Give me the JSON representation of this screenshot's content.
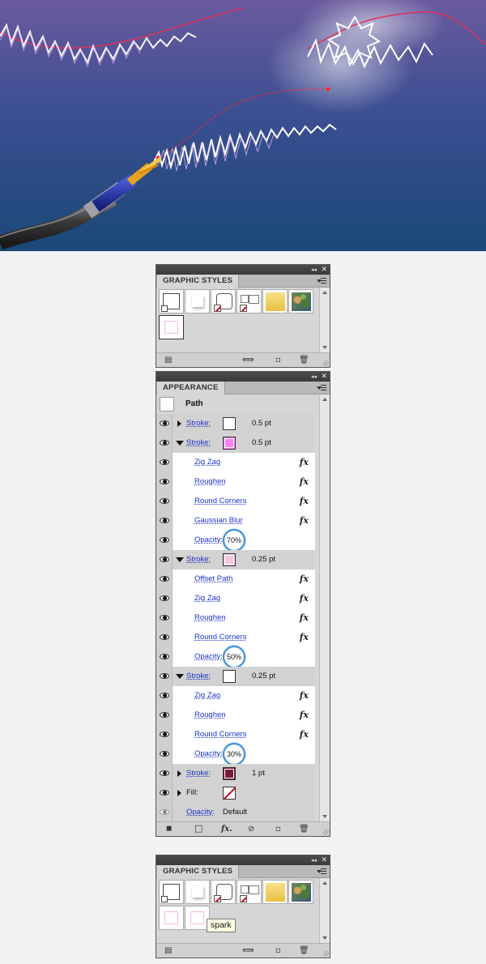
{
  "graphic_styles_panel_1": {
    "tab_label": "GRAPHIC STYLES",
    "swatches": [
      {
        "name": "default",
        "color": "#ffffff"
      },
      {
        "name": "shadow",
        "color": "#ffffff"
      },
      {
        "name": "rounded-none",
        "color": "#ffffff"
      },
      {
        "name": "double-none",
        "color": "#ffffff"
      },
      {
        "name": "gold",
        "color": "#f0d35a"
      },
      {
        "name": "texture",
        "color": "#7a8a4a"
      },
      {
        "name": "pink-outline",
        "color": "#ffffff"
      }
    ]
  },
  "appearance_panel": {
    "tab_label": "APPEARANCE",
    "header": {
      "label": "Path"
    },
    "rows": [
      {
        "kind": "group",
        "expand": "collapsed",
        "label": "Stroke:",
        "swatch": "#ffffff",
        "value": "0.5 pt"
      },
      {
        "kind": "group",
        "expand": "expanded",
        "label": "Stroke:",
        "swatch": "#ff80ff",
        "value": "0.5 pt"
      },
      {
        "kind": "child",
        "label": "Zig Zag",
        "fx": true
      },
      {
        "kind": "child",
        "label": "Roughen",
        "fx": true
      },
      {
        "kind": "child",
        "label": "Round Corners",
        "fx": true
      },
      {
        "kind": "child",
        "label": "Gaussian Blur",
        "fx": true
      },
      {
        "kind": "opacity",
        "label": "Opacity:",
        "value": "70%"
      },
      {
        "kind": "group",
        "expand": "expanded",
        "label": "Stroke:",
        "swatch": "#f4c5e0",
        "value": "0.25 pt"
      },
      {
        "kind": "child",
        "label": "Offset Path",
        "fx": true
      },
      {
        "kind": "child",
        "label": "Zig Zag",
        "fx": true
      },
      {
        "kind": "child",
        "label": "Roughen",
        "fx": true
      },
      {
        "kind": "child",
        "label": "Round Corners",
        "fx": true
      },
      {
        "kind": "opacity",
        "label": "Opacity:",
        "value": "50%"
      },
      {
        "kind": "group",
        "expand": "expanded",
        "label": "Stroke:",
        "swatch": "#ffffff",
        "value": "0.25 pt"
      },
      {
        "kind": "child",
        "label": "Zig Zag",
        "fx": true
      },
      {
        "kind": "child",
        "label": "Roughen",
        "fx": true
      },
      {
        "kind": "child",
        "label": "Round Corners",
        "fx": true
      },
      {
        "kind": "opacity",
        "label": "Opacity:",
        "value": "30%"
      },
      {
        "kind": "group",
        "expand": "collapsed",
        "label": "Stroke:",
        "swatch": "#7a1a3a",
        "value": "1 pt"
      },
      {
        "kind": "fill",
        "expand": "collapsed",
        "label": "Fill:",
        "swatch": "none"
      },
      {
        "kind": "opacity-default",
        "label": "Opacity:",
        "value": "Default"
      }
    ],
    "fx_symbol": "fx"
  },
  "graphic_styles_panel_2": {
    "tab_label": "GRAPHIC STYLES",
    "tooltip": "spark"
  },
  "colors": {
    "accent_circle": "#3b8fd6",
    "link": "#1a33c8",
    "panel_bg": "#d6d6d6"
  }
}
